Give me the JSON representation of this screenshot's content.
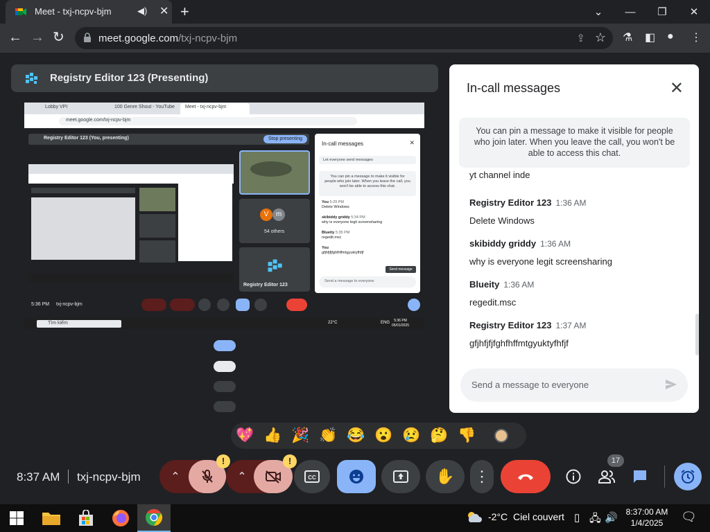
{
  "browser": {
    "tab_title": "Meet - txj-ncpv-bjm",
    "url_host": "meet.google.com",
    "url_path": "/txj-ncpv-bjm"
  },
  "presenting": {
    "title": "Registry Editor 123 (Presenting)"
  },
  "shared_screen": {
    "tabs": [
      "Lobby VPI",
      "100 Genre Shout - YouTube",
      "Meet - txj-ncpv-bjm"
    ],
    "url": "meet.google.com/txj-ncpv-bjm",
    "present_label": "Registry Editor 123 (You, presenting)",
    "stop_button": "Stop presenting",
    "others_label": "54 others",
    "tile_name": "Registry Editor 123",
    "avatar_v": "V",
    "avatar_m": "m",
    "chat_title": "In-call messages",
    "chat_toggle": "Let everyone send messages",
    "chat_info": "You can pin a message to make it visible for people who join later. When you leave the call, you won't be able to access this chat.",
    "chat_msgs": [
      {
        "who": "You",
        "time": "5:29 PM",
        "text": "Delete Windows"
      },
      {
        "who": "skibiddy griddy",
        "time": "5:34 PM",
        "text": "why is everyone legit screensharing"
      },
      {
        "who": "Blueity",
        "time": "5:35 PM",
        "text": "regedit.msc"
      },
      {
        "who": "You",
        "time": "",
        "text": "gfjhfjfjfghfhffmtgyuktyfhfjf"
      }
    ],
    "send_tip": "Send message",
    "chat_input": "Send a message to everyone",
    "clock": "5:36 PM",
    "code": "txj-ncpv-bjm",
    "taskbar_search": "Tìm kiếm",
    "temp": "22°C",
    "lang": "ENG",
    "tray_time": "5:36 PM",
    "tray_date": "05/01/2025"
  },
  "chat": {
    "title": "In-call messages",
    "info": "You can pin a message to make it visible for people who join later. When you leave the call, you won't be able to access this chat.",
    "cut_text": "yt channel inde",
    "messages": [
      {
        "sender": "Registry Editor 123",
        "time": "1:36 AM",
        "text": "Delete Windows"
      },
      {
        "sender": "skibiddy griddy",
        "time": "1:36 AM",
        "text": "why is everyone legit screensharing"
      },
      {
        "sender": "Blueity",
        "time": "1:36 AM",
        "text": "regedit.msc"
      },
      {
        "sender": "Registry Editor 123",
        "time": "1:37 AM",
        "text": "gfjhfjfjfghfhffmtgyuktyfhfjf"
      }
    ],
    "input_placeholder": "Send a message to everyone"
  },
  "reactions": [
    "💖",
    "👍",
    "🎉",
    "👏",
    "😂",
    "😮",
    "😢",
    "🤔",
    "👎"
  ],
  "controls": {
    "clock": "8:37 AM",
    "meeting_code": "txj-ncpv-bjm",
    "warning_symbol": "!",
    "people_count": "17"
  },
  "taskbar": {
    "temperature": "-2°C",
    "weather_text": "Ciel couvert",
    "time": "8:37:00 AM",
    "date": "1/4/2025"
  },
  "colors": {
    "muted_red": "#5c1d1d",
    "muted_pink": "#e4a9a3",
    "active_blue": "#8ab4f8",
    "hangup_red": "#ea4335",
    "control_gray": "#3c4043"
  }
}
